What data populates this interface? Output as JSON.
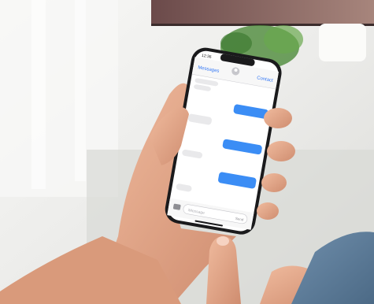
{
  "phone": {
    "status_time": "12:36",
    "nav_back_label": "Messages",
    "nav_contact_label": "Contact",
    "composer_placeholder": "iMessage",
    "composer_send_label": "Send"
  },
  "messages": [
    {
      "direction": "incoming"
    },
    {
      "direction": "incoming"
    },
    {
      "direction": "outgoing"
    },
    {
      "direction": "incoming"
    },
    {
      "direction": "outgoing"
    },
    {
      "direction": "incoming"
    },
    {
      "direction": "outgoing"
    },
    {
      "direction": "incoming"
    }
  ],
  "colors": {
    "wall": "#eeeeec",
    "window_light": "#f7f8f6",
    "table": "#d9dad6",
    "skin": "#e4a98b",
    "skin_shadow": "#c98467",
    "sleeve": "#5e7d9a",
    "plant": "#4c8a3a",
    "phone_body": "#1a1a1c",
    "screen": "#ffffff",
    "incoming_bubble": "#e9e9eb",
    "outgoing_bubble": "#3b8df5",
    "accent_blue": "#3478f6"
  }
}
